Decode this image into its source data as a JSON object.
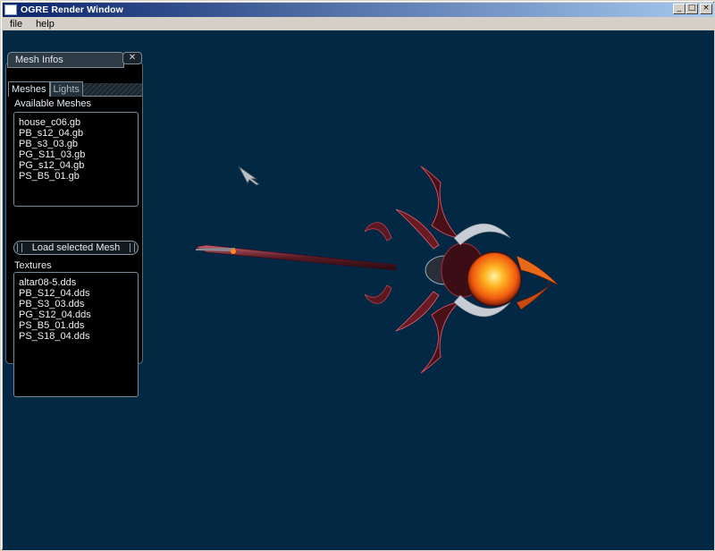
{
  "window": {
    "title": "OGRE Render Window"
  },
  "menu": {
    "items": [
      "file",
      "help"
    ]
  },
  "panel": {
    "title": "Mesh Infos",
    "tabs": [
      {
        "label": "Meshes",
        "active": true
      },
      {
        "label": "Lights",
        "active": false
      }
    ],
    "available_meshes_label": "Available Meshes",
    "meshes": [
      "house_c06.gb",
      "PB_s12_04.gb",
      "PB_s3_03.gb",
      "PG_S11_03.gb",
      "PG_s12_04.gb",
      "PS_B5_01.gb"
    ],
    "load_button_label": "Load selected Mesh",
    "textures_label": "Textures",
    "textures": [
      "altar08-5.dds",
      "PB_S12_04.dds",
      "PB_S3_03.dds",
      "PG_S12_04.dds",
      "PS_B5_01.dds",
      "PS_S18_04.dds"
    ]
  },
  "colors": {
    "viewport_background": "#022844",
    "titlebar_start": "#0a246a",
    "titlebar_end": "#a6caf0",
    "orb": "#ff7a1a"
  },
  "icons": {
    "close": "close-icon",
    "minimize": "minimize-icon",
    "maximize": "maximize-icon",
    "cursor": "arrow-cursor-icon"
  }
}
